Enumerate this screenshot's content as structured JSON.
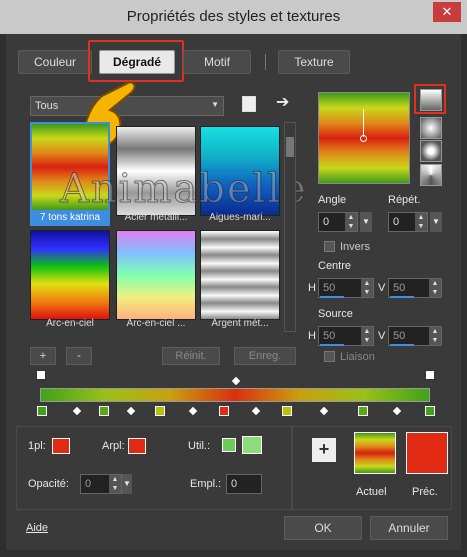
{
  "window": {
    "title": "Propriétés des styles et textures",
    "close_glyph": "✕"
  },
  "tabs": [
    {
      "label": "Couleur"
    },
    {
      "label": "Dégradé"
    },
    {
      "label": "Motif"
    },
    {
      "label": "Texture"
    }
  ],
  "preset_dropdown": {
    "value": "Tous"
  },
  "watermark": "Animabelle",
  "gradients": [
    {
      "label": "7 tons katrina"
    },
    {
      "label": "Acier métalli..."
    },
    {
      "label": "Aigues-mari..."
    },
    {
      "label": "Arc-en-ciel"
    },
    {
      "label": "Arc-en-ciel ..."
    },
    {
      "label": "Argent mét..."
    }
  ],
  "gradient_buttons": {
    "add": "+",
    "remove": "-",
    "reset": "Réinit.",
    "save": "Enreg."
  },
  "angle": {
    "label": "Angle",
    "value": "0"
  },
  "repeat": {
    "label": "Répét.",
    "value": "0"
  },
  "invert": {
    "label": "Invers"
  },
  "center": {
    "label": "Centre",
    "h_label": "H",
    "h_value": "50",
    "v_label": "V",
    "v_value": "50"
  },
  "source": {
    "label": "Source",
    "h_label": "H",
    "h_value": "50",
    "v_label": "V",
    "v_value": "50"
  },
  "link": {
    "label": "Liaison"
  },
  "bottom": {
    "fg_label": "1pl:",
    "bg_label": "Arpl:",
    "use_label": "Util.:",
    "opacity_label": "Opacité:",
    "opacity_value": "0",
    "location_label": "Empl.:",
    "location_value": "0"
  },
  "swatches": {
    "add_glyph": "+",
    "current_label": "Actuel",
    "previous_label": "Préc."
  },
  "footer": {
    "help": "Aide",
    "ok": "OK",
    "cancel": "Annuler"
  },
  "colors": {
    "accent_red": "#e02a12",
    "highlight": "#e03020"
  }
}
